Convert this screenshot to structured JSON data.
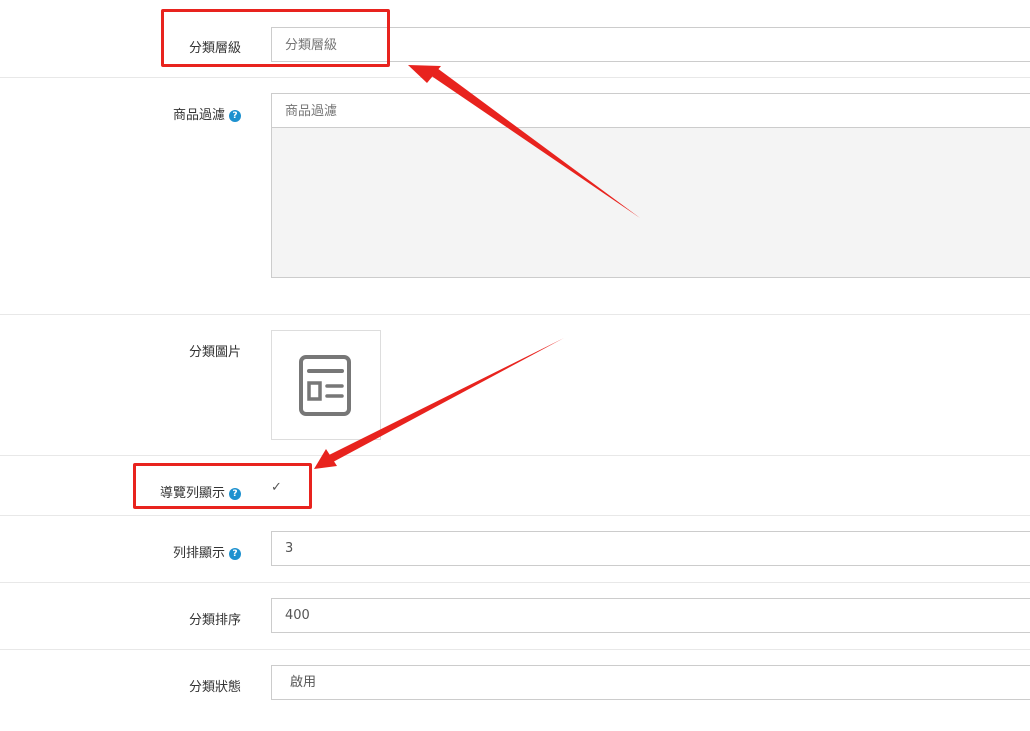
{
  "form": {
    "category_level": {
      "label": "分類層級",
      "placeholder": "分類層級",
      "value": ""
    },
    "product_filter": {
      "label": "商品過濾",
      "placeholder": "商品過濾",
      "value": "",
      "help_icon": "?"
    },
    "category_image": {
      "label": "分類圖片",
      "icon": "image-placeholder-icon"
    },
    "navbar_display": {
      "label": "導覽列顯示",
      "help_icon": "?",
      "checked": true,
      "check_glyph": "✓"
    },
    "column_display": {
      "label": "列排顯示",
      "help_icon": "?",
      "value": "3"
    },
    "sort_order": {
      "label": "分類排序",
      "value": "400"
    },
    "status": {
      "label": "分類狀態",
      "value": "啟用"
    }
  },
  "annotations": {
    "highlight_color": "#e8231e"
  }
}
